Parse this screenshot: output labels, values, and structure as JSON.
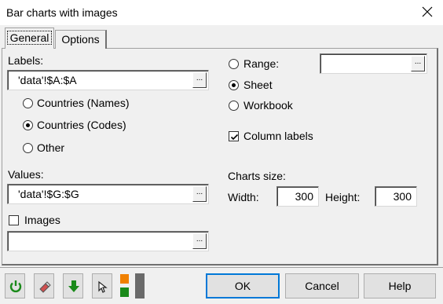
{
  "window": {
    "title": "Bar charts with images"
  },
  "tabs": [
    {
      "label": "General"
    },
    {
      "label": "Options"
    }
  ],
  "labels_section": {
    "label": "Labels:",
    "value": "'data'!$A:$A",
    "options": [
      {
        "label": "Countries (Names)",
        "selected": false
      },
      {
        "label": "Countries (Codes)",
        "selected": true
      },
      {
        "label": "Other",
        "selected": false
      }
    ]
  },
  "values_section": {
    "label": "Values:",
    "value": "'data'!$G:$G"
  },
  "images": {
    "label": "Images",
    "checked": false,
    "value": ""
  },
  "scope": {
    "range_label": "Range:",
    "range_value": "",
    "sheet_label": "Sheet",
    "workbook_label": "Workbook",
    "selected": "Sheet"
  },
  "column_labels": {
    "label": "Column labels",
    "checked": true
  },
  "charts_size": {
    "label": "Charts size:",
    "width_label": "Width:",
    "width_value": "300",
    "height_label": "Height:",
    "height_value": "300"
  },
  "buttons": {
    "ok": "OK",
    "cancel": "Cancel",
    "help": "Help",
    "browse": "..."
  },
  "toolbar": [
    "refresh-icon",
    "eraser-icon",
    "download-arrow-icon",
    "cursor-icon",
    "color-swatch-icon"
  ],
  "colors": {
    "accent": "#0078d7",
    "green": "#1a8a1a",
    "orange": "#f08000"
  }
}
